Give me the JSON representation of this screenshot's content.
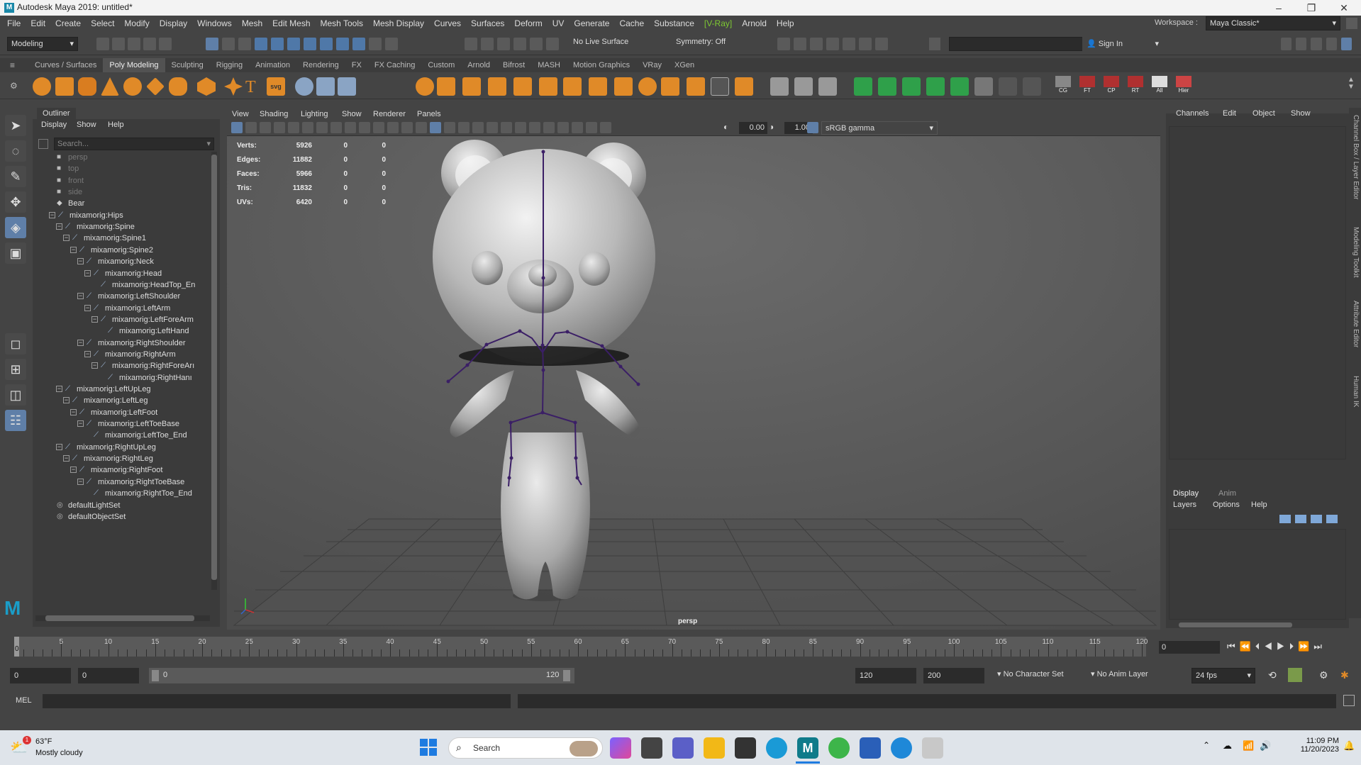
{
  "titlebar": {
    "title": "Autodesk Maya 2019: untitled*",
    "minimize": "–",
    "maximize": "❐",
    "close": "✕"
  },
  "menubar": [
    "File",
    "Edit",
    "Create",
    "Select",
    "Modify",
    "Display",
    "Windows",
    "Mesh",
    "Edit Mesh",
    "Mesh Tools",
    "Mesh Display",
    "Curves",
    "Surfaces",
    "Deform",
    "UV",
    "Generate",
    "Cache",
    "Substance",
    "[V-Ray]",
    "Arnold",
    "Help"
  ],
  "workspace": {
    "label": "Workspace :",
    "value": "Maya Classic*"
  },
  "statusline": {
    "mode": "Modeling",
    "live_surface": "No Live Surface",
    "symmetry": "Symmetry: Off",
    "sign_in": "Sign In"
  },
  "shelf_tabs": [
    "Curves / Surfaces",
    "Poly Modeling",
    "Sculpting",
    "Rigging",
    "Animation",
    "Rendering",
    "FX",
    "FX Caching",
    "Custom",
    "Arnold",
    "Bifrost",
    "MASH",
    "Motion Graphics",
    "VRay",
    "XGen"
  ],
  "shelf_active": "Poly Modeling",
  "shelf_labels": [
    "CG",
    "FT",
    "CP",
    "RT",
    "All",
    "Hier"
  ],
  "outliner": {
    "tab": "Outliner",
    "menu": [
      "Display",
      "Show",
      "Help"
    ],
    "search_placeholder": "Search...",
    "rows": [
      {
        "label": "persp",
        "depth": 0,
        "kind": "camera",
        "dim": true
      },
      {
        "label": "top",
        "depth": 0,
        "kind": "camera",
        "dim": true
      },
      {
        "label": "front",
        "depth": 0,
        "kind": "camera",
        "dim": true
      },
      {
        "label": "side",
        "depth": 0,
        "kind": "camera",
        "dim": true
      },
      {
        "label": "Bear",
        "depth": 0,
        "kind": "mesh"
      },
      {
        "label": "mixamorig:Hips",
        "depth": 1,
        "kind": "joint",
        "exp": "−"
      },
      {
        "label": "mixamorig:Spine",
        "depth": 2,
        "kind": "joint",
        "exp": "−"
      },
      {
        "label": "mixamorig:Spine1",
        "depth": 3,
        "kind": "joint",
        "exp": "−"
      },
      {
        "label": "mixamorig:Spine2",
        "depth": 4,
        "kind": "joint",
        "exp": "−"
      },
      {
        "label": "mixamorig:Neck",
        "depth": 5,
        "kind": "joint",
        "exp": "−"
      },
      {
        "label": "mixamorig:Head",
        "depth": 6,
        "kind": "joint",
        "exp": "−"
      },
      {
        "label": "mixamorig:HeadTop_En",
        "depth": 7,
        "kind": "joint"
      },
      {
        "label": "mixamorig:LeftShoulder",
        "depth": 5,
        "kind": "joint",
        "exp": "−"
      },
      {
        "label": "mixamorig:LeftArm",
        "depth": 6,
        "kind": "joint",
        "exp": "−"
      },
      {
        "label": "mixamorig:LeftForeArm",
        "depth": 7,
        "kind": "joint",
        "exp": "−"
      },
      {
        "label": "mixamorig:LeftHand",
        "depth": 8,
        "kind": "joint"
      },
      {
        "label": "mixamorig:RightShoulder",
        "depth": 5,
        "kind": "joint",
        "exp": "−"
      },
      {
        "label": "mixamorig:RightArm",
        "depth": 6,
        "kind": "joint",
        "exp": "−"
      },
      {
        "label": "mixamorig:RightForeArı",
        "depth": 7,
        "kind": "joint",
        "exp": "−"
      },
      {
        "label": "mixamorig:RightHanı",
        "depth": 8,
        "kind": "joint"
      },
      {
        "label": "mixamorig:LeftUpLeg",
        "depth": 2,
        "kind": "joint",
        "exp": "−"
      },
      {
        "label": "mixamorig:LeftLeg",
        "depth": 3,
        "kind": "joint",
        "exp": "−"
      },
      {
        "label": "mixamorig:LeftFoot",
        "depth": 4,
        "kind": "joint",
        "exp": "−"
      },
      {
        "label": "mixamorig:LeftToeBase",
        "depth": 5,
        "kind": "joint",
        "exp": "−"
      },
      {
        "label": "mixamorig:LeftToe_End",
        "depth": 6,
        "kind": "joint"
      },
      {
        "label": "mixamorig:RightUpLeg",
        "depth": 2,
        "kind": "joint",
        "exp": "−"
      },
      {
        "label": "mixamorig:RightLeg",
        "depth": 3,
        "kind": "joint",
        "exp": "−"
      },
      {
        "label": "mixamorig:RightFoot",
        "depth": 4,
        "kind": "joint",
        "exp": "−"
      },
      {
        "label": "mixamorig:RightToeBase",
        "depth": 5,
        "kind": "joint",
        "exp": "−"
      },
      {
        "label": "mixamorig:RightToe_End",
        "depth": 6,
        "kind": "joint"
      },
      {
        "label": "defaultLightSet",
        "depth": 0,
        "kind": "set"
      },
      {
        "label": "defaultObjectSet",
        "depth": 0,
        "kind": "set"
      }
    ]
  },
  "viewport": {
    "menu": [
      "View",
      "Shading",
      "Lighting",
      "Show",
      "Renderer",
      "Panels"
    ],
    "exposure": "0.00",
    "gamma": "1.00",
    "color_space": "sRGB gamma",
    "camera": "persp",
    "hud": [
      {
        "label": "Verts:",
        "v1": "5926",
        "v2": "0",
        "v3": "0"
      },
      {
        "label": "Edges:",
        "v1": "11882",
        "v2": "0",
        "v3": "0"
      },
      {
        "label": "Faces:",
        "v1": "5966",
        "v2": "0",
        "v3": "0"
      },
      {
        "label": "Tris:",
        "v1": "11832",
        "v2": "0",
        "v3": "0"
      },
      {
        "label": "UVs:",
        "v1": "6420",
        "v2": "0",
        "v3": "0"
      }
    ]
  },
  "channelbox": {
    "menu": [
      "Channels",
      "Edit",
      "Object",
      "Show"
    ],
    "layer_tabs": [
      "Display",
      "Anim"
    ],
    "layer_menu": [
      "Layers",
      "Options",
      "Help"
    ]
  },
  "side_tabs": [
    "Channel Box / Layer Editor",
    "Modeling Toolkit",
    "Attribute Editor",
    "Human IK"
  ],
  "timeline": {
    "ticks": [
      "5",
      "10",
      "15",
      "20",
      "25",
      "30",
      "35",
      "40",
      "45",
      "50",
      "55",
      "60",
      "65",
      "70",
      "75",
      "80",
      "85",
      "90",
      "95",
      "100",
      "105",
      "110",
      "115",
      "120"
    ],
    "current": "0",
    "frame_field": "0"
  },
  "range": {
    "start": "0",
    "anim_start": "0",
    "slider_start": "0",
    "slider_end": "120",
    "end": "120",
    "anim_end": "200",
    "character_set": "No Character Set",
    "anim_layer": "No Anim Layer",
    "fps": "24 fps"
  },
  "cmdline": {
    "label": "MEL"
  },
  "taskbar": {
    "temp": "63°F",
    "weather": "Mostly cloudy",
    "search": "Search",
    "time": "11:09 PM",
    "date": "11/20/2023",
    "weather_badge": "1"
  }
}
